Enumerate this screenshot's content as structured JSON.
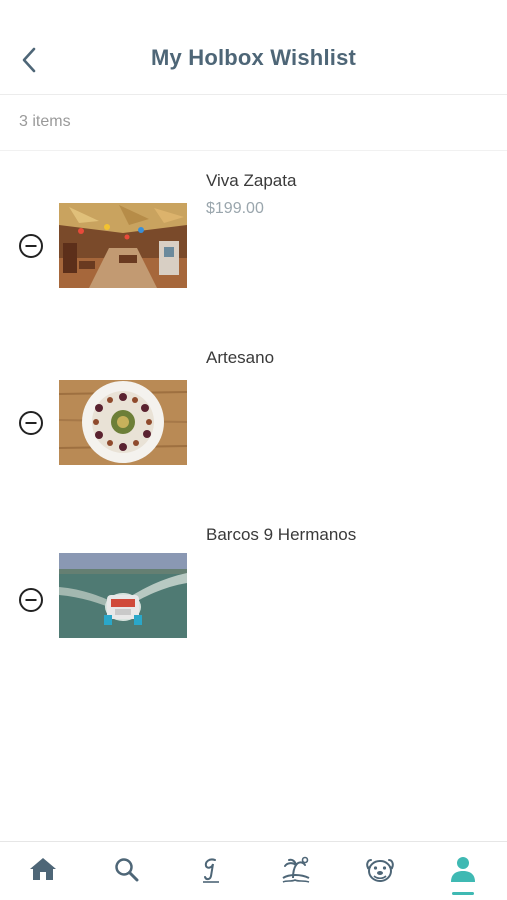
{
  "header": {
    "title": "My Holbox Wishlist",
    "back_icon": "chevron-left-icon"
  },
  "wishlist": {
    "count_label": "3 items",
    "items": [
      {
        "name": "Viva Zapata",
        "price": "$199.00",
        "image": "restaurant-interior-photo"
      },
      {
        "name": "Artesano",
        "price": "",
        "image": "plated-dish-photo"
      },
      {
        "name": "Barcos 9 Hermanos",
        "price": "",
        "image": "boat-aerial-photo"
      }
    ]
  },
  "tabbar": {
    "tabs": [
      "home-icon",
      "search-icon",
      "guide-icon",
      "island-icon",
      "bulldog-icon",
      "profile-icon"
    ],
    "active": "profile-icon",
    "accent_color": "#3fb9b3",
    "icon_color": "#4e6677"
  }
}
